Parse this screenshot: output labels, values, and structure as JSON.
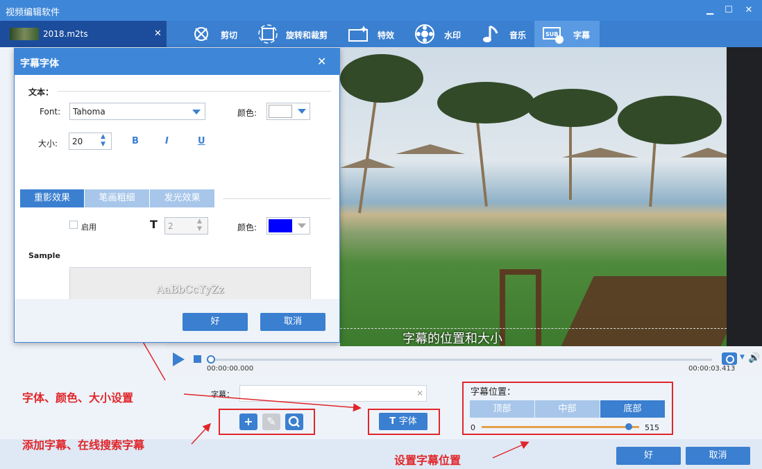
{
  "app": {
    "title": "视频编辑软件"
  },
  "file_tab": {
    "name": "2018.m2ts",
    "close": "✕"
  },
  "toolbar": {
    "items": [
      {
        "label": "剪切",
        "icon": "scissors-icon"
      },
      {
        "label": "旋转和裁剪",
        "icon": "rotate-crop-icon"
      },
      {
        "label": "特效",
        "icon": "effects-icon"
      },
      {
        "label": "水印",
        "icon": "watermark-icon"
      },
      {
        "label": "音乐",
        "icon": "music-icon"
      },
      {
        "label": "字幕",
        "icon": "subtitle-icon",
        "active": true
      }
    ]
  },
  "video": {
    "subtitle_preview": "字幕的位置和大小"
  },
  "player": {
    "current_time": "00:00:00.000",
    "total_time": "00:00:03.413",
    "progress": 0
  },
  "dialog": {
    "title": "字幕字体",
    "text_section": "文本：",
    "font_label": "Font:",
    "font_value": "Tahoma",
    "color_label": "颜色:",
    "text_color": "#ffffff",
    "size_label": "大小:",
    "size_value": "20",
    "bold": "B",
    "italic": "I",
    "underline": "U",
    "tabs": [
      "重影效果",
      "笔画粗细",
      "发光效果"
    ],
    "enable_label": "启用",
    "enable_checked": false,
    "shadow_size": "2",
    "shadow_color": "#0000ff",
    "color2_label": "颜色:",
    "sample_label": "Sample",
    "sample_text": "AaBbCcYyZz",
    "ok": "好",
    "cancel": "取消"
  },
  "subtitle_panel": {
    "subtitle_label": "字幕：",
    "subtitle_value": "",
    "font_button": "字体",
    "position_title": "字幕位置：",
    "positions": [
      "顶部",
      "中部",
      "底部"
    ],
    "selected_position": "底部",
    "slider_min": "0",
    "slider_value": "515",
    "ok": "好",
    "cancel": "取消"
  },
  "annotations": {
    "font_settings": "字体、颜色、大小设置",
    "add_search": "添加字幕、在线搜索字幕",
    "position": "设置字幕位置"
  },
  "colors": {
    "accent": "#3a7fd0",
    "title_bar": "#3e86d8",
    "annotation": "#e0262a"
  }
}
